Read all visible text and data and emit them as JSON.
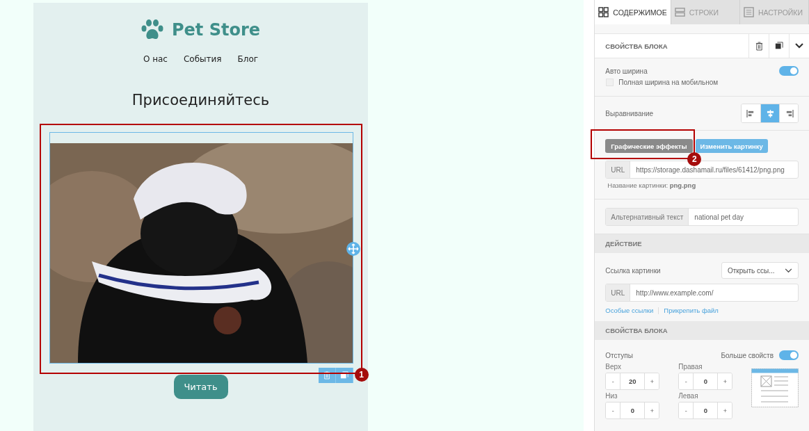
{
  "email": {
    "logo": "Pet Store",
    "nav": [
      "О нас",
      "События",
      "Блог"
    ],
    "heading": "Присоединяйтесь",
    "image": {
      "kind": "picture"
    },
    "button": "Читать"
  },
  "callouts": [
    {
      "label": "1"
    },
    {
      "label": "2"
    }
  ],
  "panel": {
    "tabs": [
      {
        "kind": "content",
        "label": "СОДЕРЖИМОЕ",
        "selected": true
      },
      {
        "kind": "rows",
        "label": "СТРОКИ",
        "selected": false
      },
      {
        "kind": "settings",
        "label": "НАСТРОЙКИ",
        "selected": false
      }
    ],
    "block_header": "СВОЙСТВА БЛОКА",
    "auto_width": {
      "label": "Авто ширина",
      "on": true
    },
    "mobile_full": {
      "label": "Полная ширина на мобильном",
      "checked": false
    },
    "alignment": {
      "label": "Выравнивание",
      "options": [
        {
          "kind": "left",
          "selected": false
        },
        {
          "kind": "center",
          "selected": true
        },
        {
          "kind": "right",
          "selected": false
        }
      ]
    },
    "effects_button": "Графические эффекты",
    "change_button": "Изменить картинку",
    "url": {
      "prefix": "URL",
      "value": "https://storage.dashamail.ru/files/61412/png.png"
    },
    "image_name": "Название картинки: **png.png**",
    "alt": {
      "prefix": "Альтернативный текст",
      "value": "national pet day"
    },
    "action_header": "ДЕЙСТВИЕ",
    "link": {
      "label": "Ссылка картинки",
      "value": "Открыть ссы..."
    },
    "link_url": {
      "prefix": "URL",
      "value": "http://www.example.com/"
    },
    "links": [
      "Особые ссылки",
      "Прикрепить файл"
    ],
    "props_header": "СВОЙСТВА БЛОКА",
    "paddings": {
      "label": "Отступы",
      "more": {
        "label": "Больше свойств",
        "on": true
      },
      "fields": [
        {
          "label": "Верх",
          "value": "20",
          "decrement": "-",
          "increment": "+"
        },
        {
          "label": "Правая",
          "value": "0",
          "decrement": "-",
          "increment": "+"
        },
        {
          "label": "Низ",
          "value": "0",
          "decrement": "-",
          "increment": "+"
        },
        {
          "label": "Левая",
          "value": "0",
          "decrement": "-",
          "increment": "+"
        }
      ]
    }
  }
}
